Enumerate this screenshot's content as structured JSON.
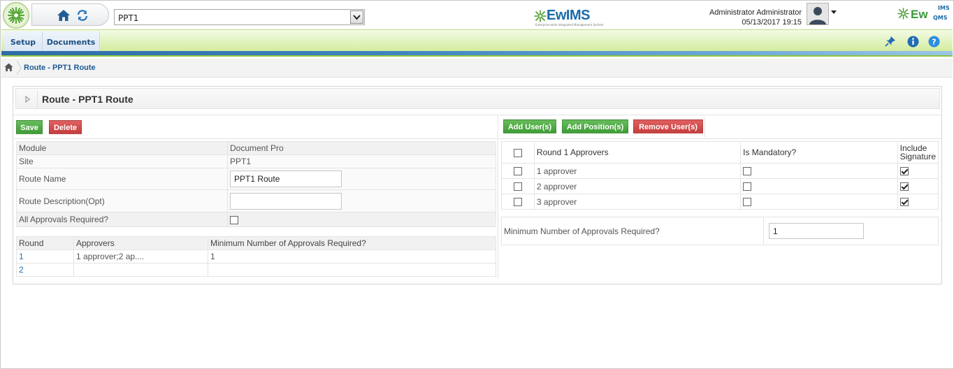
{
  "header": {
    "site_selected": "PPT1",
    "brand_center": "EwIMS",
    "brand_center_tagline": "Enterprise-wide Integrated Management System",
    "brand_right_main": "Ew",
    "brand_right_top": "IMS",
    "brand_right_bottom": "QMS",
    "user_name": "Administrator Administrator",
    "date_time": "05/13/2017 19:15",
    "icons": [
      "app-logo-icon",
      "home-icon",
      "refresh-icon",
      "dropdown-arrow-icon",
      "user-avatar-icon",
      "caret-down-icon"
    ]
  },
  "menu": {
    "items": [
      {
        "label": "Setup"
      },
      {
        "label": "Documents"
      }
    ],
    "right_icons": [
      "pin-icon",
      "info-icon",
      "help-icon"
    ]
  },
  "breadcrumb": {
    "text": "Route - PPT1 Route"
  },
  "panel": {
    "title": "Route - PPT1 Route",
    "left_buttons": {
      "save": "Save",
      "delete": "Delete"
    },
    "right_buttons": {
      "add_users": "Add User(s)",
      "add_positions": "Add Position(s)",
      "remove_users": "Remove User(s)"
    },
    "form": {
      "module_label": "Module",
      "module_value": "Document Pro",
      "site_label": "Site",
      "site_value": "PPT1",
      "route_name_label": "Route Name",
      "route_name_value": "PPT1 Route",
      "route_desc_label": "Route Description(Opt)",
      "route_desc_value": "",
      "all_approvals_label": "All Approvals Required?",
      "all_approvals_checked": false
    },
    "rounds": {
      "headers": [
        "Round",
        "Approvers",
        "Minimum Number of Approvals Required?"
      ],
      "rows": [
        {
          "round": "1",
          "approvers": "1 approver;2 ap....",
          "min": "1"
        },
        {
          "round": "2",
          "approvers": "",
          "min": ""
        }
      ]
    },
    "approvers": {
      "headers": [
        "Round 1 Approvers",
        "Is Mandatory?",
        "Include Signature"
      ],
      "rows": [
        {
          "name": "1 approver",
          "mandatory": false,
          "signature": true
        },
        {
          "name": "2 approver",
          "mandatory": false,
          "signature": true
        },
        {
          "name": "3 approver",
          "mandatory": false,
          "signature": true
        }
      ],
      "min_label": "Minimum Number of Approvals Required?",
      "min_value": "1"
    }
  }
}
